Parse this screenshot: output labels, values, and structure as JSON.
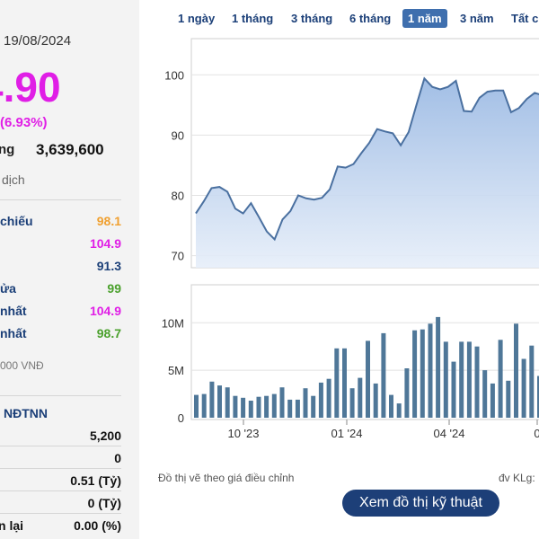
{
  "header": {
    "date_fragment": "19/08/2024"
  },
  "price": {
    "current": "4.90",
    "change_pct": "(6.93%)"
  },
  "volume": {
    "label": "ng",
    "value": "3,639,600"
  },
  "trade_label": "dịch",
  "stats": [
    {
      "label": "chiếu",
      "value": "98.1",
      "color": "#f0a030"
    },
    {
      "label": "",
      "value": "104.9",
      "color": "#e01ee6"
    },
    {
      "label": "",
      "value": "91.3",
      "color": "#1b3f78"
    },
    {
      "label": "ửa",
      "value": "99",
      "color": "#4aa02c"
    },
    {
      "label": "nhất",
      "value": "104.9",
      "color": "#e01ee6"
    },
    {
      "label": "nhất",
      "value": "98.7",
      "color": "#4aa02c"
    }
  ],
  "unit_text": "000 VNĐ",
  "foreign": {
    "title": "NĐTNN",
    "rows": [
      {
        "label": "",
        "value": "5,200"
      },
      {
        "label": "",
        "value": "0"
      },
      {
        "label": "",
        "value": "0.51 (Tỷ)"
      },
      {
        "label": "",
        "value": "0 (Tỷ)"
      },
      {
        "label": "n lại",
        "value": "0.00 (%)"
      }
    ]
  },
  "tabs": [
    "1 ngày",
    "1 tháng",
    "3 tháng",
    "6 tháng",
    "1 năm",
    "3 năm",
    "Tất c"
  ],
  "active_tab": "1 năm",
  "chart_data": {
    "type": "area",
    "price_series": [
      77,
      79,
      81.2,
      81.4,
      80.6,
      77.8,
      77,
      78.7,
      76.4,
      74,
      72.7,
      76,
      77.4,
      80,
      79.5,
      79.3,
      79.6,
      81,
      84.8,
      84.6,
      85.2,
      87,
      88.7,
      91,
      90.6,
      90.3,
      88.3,
      90.5,
      95,
      99.4,
      98,
      97.6,
      98,
      99,
      94,
      93.9,
      96.2,
      97.2,
      97.4,
      97.4,
      93.8,
      94.5,
      96,
      97,
      96.6
    ],
    "price_ylim": [
      68,
      106
    ],
    "price_ticks": [
      "100",
      "90",
      "80",
      "70"
    ],
    "volume_series_millions": [
      2.4,
      2.5,
      3.8,
      3.4,
      3.2,
      2.3,
      2.1,
      1.8,
      2.2,
      2.3,
      2.5,
      3.2,
      1.9,
      1.9,
      3.1,
      2.3,
      3.7,
      4.1,
      7.3,
      7.3,
      3.1,
      4.2,
      8.1,
      3.6,
      8.9,
      2.4,
      1.5,
      5.2,
      9.2,
      9.3,
      9.9,
      10.6,
      8.0,
      5.9,
      8.0,
      8.0,
      7.5,
      5.0,
      3.6,
      8.2,
      3.9,
      9.9,
      6.2,
      7.6,
      4.4
    ],
    "volume_ylim": [
      0,
      14
    ],
    "volume_ticks": [
      "10M",
      "5M",
      "0"
    ],
    "x_labels": [
      "10 '23",
      "01 '24",
      "04 '24",
      "0"
    ],
    "grid": true
  },
  "notes": {
    "adjusted": "Đồ thị vẽ theo giá điều chỉnh",
    "volume_unit": "đv KLg:"
  },
  "tech_button": "Xem đồ thị kỹ thuật",
  "colors": {
    "line": "#4a70a0",
    "area_top": "#a9c3e6",
    "bar": "#4f7798",
    "accent_magenta": "#e01ee6",
    "button": "#1d3f78"
  }
}
